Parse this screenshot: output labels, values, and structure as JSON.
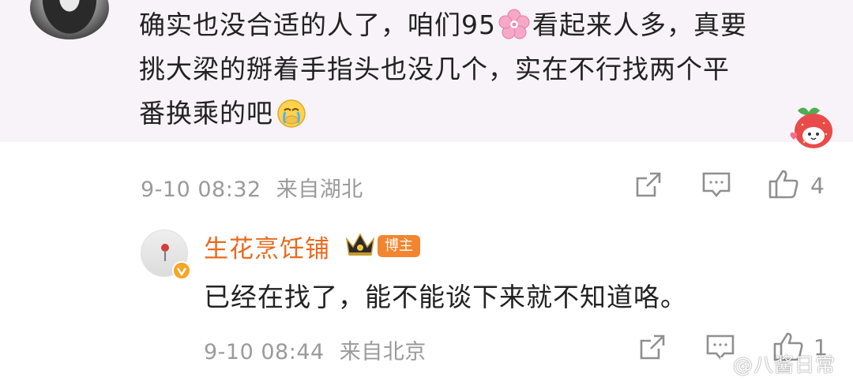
{
  "comment": {
    "text_line1_a": "确实也没合适的人了，咱们95",
    "emoji_1": "cherry-blossom-icon",
    "text_line1_b": "看起来人多，真要",
    "text_line2": "挑大梁的掰着手指头也没几个，实在不行找两个平",
    "text_line3": "番换乘的吧",
    "emoji_2": "crying-face-icon",
    "timestamp": "9-10 08:32",
    "location": "来自湖北",
    "like_count": "4"
  },
  "reply": {
    "username": "生花烹饪铺",
    "badge": "博主",
    "text": "已经在找了，能不能谈下来就不知道咯。",
    "timestamp": "9-10 08:44",
    "location": "来自北京",
    "like_count": "1"
  },
  "watermark": "@八酱日常",
  "colors": {
    "card_bg": "#f8f3f8",
    "username": "#e86a1c",
    "badge_bg": "#f2852f",
    "meta_text": "#9a9a9a"
  }
}
